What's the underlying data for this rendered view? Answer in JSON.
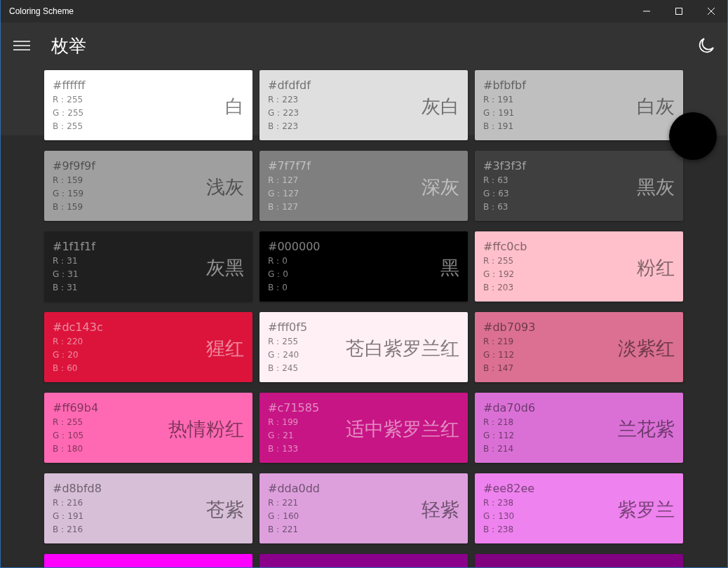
{
  "window": {
    "title": "Coloring Scheme"
  },
  "header": {
    "title": "枚举"
  },
  "cards": [
    {
      "hex": "#ffffff",
      "rgb": [
        "R：255",
        "G：255",
        "B：255"
      ],
      "name": "白",
      "color": "#ffffff"
    },
    {
      "hex": "#dfdfdf",
      "rgb": [
        "R：223",
        "G：223",
        "B：223"
      ],
      "name": "灰白",
      "color": "#dfdfdf"
    },
    {
      "hex": "#bfbfbf",
      "rgb": [
        "R：191",
        "G：191",
        "B：191"
      ],
      "name": "白灰",
      "color": "#bfbfbf"
    },
    {
      "hex": "#9f9f9f",
      "rgb": [
        "R：159",
        "G：159",
        "B：159"
      ],
      "name": "浅灰",
      "color": "#9f9f9f"
    },
    {
      "hex": "#7f7f7f",
      "rgb": [
        "R：127",
        "G：127",
        "B：127"
      ],
      "name": "深灰",
      "color": "#7f7f7f"
    },
    {
      "hex": "#3f3f3f",
      "rgb": [
        "R：63",
        "G：63",
        "B：63"
      ],
      "name": "黑灰",
      "color": "#3f3f3f"
    },
    {
      "hex": "#1f1f1f",
      "rgb": [
        "R：31",
        "G：31",
        "B：31"
      ],
      "name": "灰黑",
      "color": "#1f1f1f"
    },
    {
      "hex": "#000000",
      "rgb": [
        "R：0",
        "G：0",
        "B：0"
      ],
      "name": "黑",
      "color": "#000000"
    },
    {
      "hex": "#ffc0cb",
      "rgb": [
        "R：255",
        "G：192",
        "B：203"
      ],
      "name": "粉红",
      "color": "#ffc0cb"
    },
    {
      "hex": "#dc143c",
      "rgb": [
        "R：220",
        "G：20",
        "B：60"
      ],
      "name": "猩红",
      "color": "#dc143c"
    },
    {
      "hex": "#fff0f5",
      "rgb": [
        "R：255",
        "G：240",
        "B：245"
      ],
      "name": "苍白紫罗兰红",
      "color": "#fff0f5"
    },
    {
      "hex": "#db7093",
      "rgb": [
        "R：219",
        "G：112",
        "B：147"
      ],
      "name": "淡紫红",
      "color": "#db7093"
    },
    {
      "hex": "#ff69b4",
      "rgb": [
        "R：255",
        "G：105",
        "B：180"
      ],
      "name": "热情粉红",
      "color": "#ff69b4"
    },
    {
      "hex": "#c71585",
      "rgb": [
        "R：199",
        "G：21",
        "B：133"
      ],
      "name": "适中紫罗兰红",
      "color": "#c71585"
    },
    {
      "hex": "#da70d6",
      "rgb": [
        "R：218",
        "G：112",
        "B：214"
      ],
      "name": "兰花紫",
      "color": "#da70d6"
    },
    {
      "hex": "#d8bfd8",
      "rgb": [
        "R：216",
        "G：191",
        "B：216"
      ],
      "name": "苍紫",
      "color": "#d8bfd8"
    },
    {
      "hex": "#dda0dd",
      "rgb": [
        "R：221",
        "G：160",
        "B：221"
      ],
      "name": "轻紫",
      "color": "#dda0dd"
    },
    {
      "hex": "#ee82ee",
      "rgb": [
        "R：238",
        "G：130",
        "B：238"
      ],
      "name": "紫罗兰",
      "color": "#ee82ee"
    },
    {
      "color": "#ff00ff"
    },
    {
      "color": "#8b008b"
    },
    {
      "color": "#800080"
    }
  ]
}
